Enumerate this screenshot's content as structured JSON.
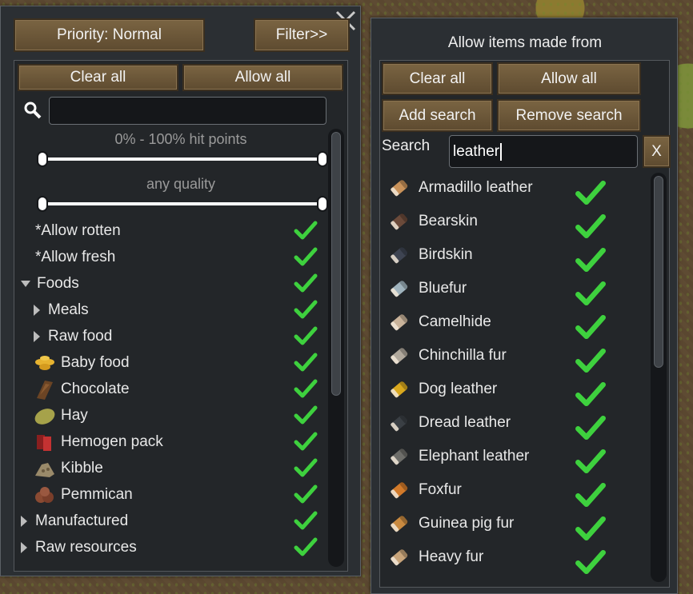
{
  "colors": {
    "check": "#3ed13e",
    "button": "#6f5a3a",
    "panel": "#2b2f33"
  },
  "left": {
    "priority_label": "Priority: Normal",
    "filter_label": "Filter>>",
    "clear_all": "Clear all",
    "allow_all": "Allow all",
    "search_value": "",
    "hitpoints_label": "0% - 100% hit points",
    "hitpoints_range": [
      0,
      100
    ],
    "quality_label": "any quality",
    "rows": [
      {
        "label": "*Allow rotten",
        "indent": 0,
        "icon": "none",
        "checked": true
      },
      {
        "label": "*Allow fresh",
        "indent": 0,
        "icon": "none",
        "checked": true
      },
      {
        "label": "Foods",
        "indent": 0,
        "icon": "expanded-triangle-icon",
        "checked": true
      },
      {
        "label": "Meals",
        "indent": 1,
        "icon": "collapsed-triangle-icon",
        "checked": true
      },
      {
        "label": "Raw food",
        "indent": 1,
        "icon": "collapsed-triangle-icon",
        "checked": true
      },
      {
        "label": "Baby food",
        "indent": 1,
        "icon": "baby-food-icon",
        "checked": true
      },
      {
        "label": "Chocolate",
        "indent": 1,
        "icon": "chocolate-icon",
        "checked": true
      },
      {
        "label": "Hay",
        "indent": 1,
        "icon": "hay-icon",
        "checked": true
      },
      {
        "label": "Hemogen pack",
        "indent": 1,
        "icon": "hemogen-pack-icon",
        "checked": true
      },
      {
        "label": "Kibble",
        "indent": 1,
        "icon": "kibble-icon",
        "checked": true
      },
      {
        "label": "Pemmican",
        "indent": 1,
        "icon": "pemmican-icon",
        "checked": true
      },
      {
        "label": "Manufactured",
        "indent": 0,
        "icon": "collapsed-triangle-icon",
        "checked": true
      },
      {
        "label": "Raw resources",
        "indent": 0,
        "icon": "collapsed-triangle-icon",
        "checked": true
      }
    ]
  },
  "right": {
    "title": "Allow items made from",
    "clear_all": "Clear all",
    "allow_all": "Allow all",
    "add_search": "Add search",
    "remove_search": "Remove search",
    "search_label": "Search",
    "search_value": "leather",
    "clear_x": "X",
    "items": [
      {
        "label": "Armadillo leather",
        "color": "#c9925a",
        "checked": true
      },
      {
        "label": "Bearskin",
        "color": "#6b4a3a",
        "checked": true
      },
      {
        "label": "Birdskin",
        "color": "#3e4452",
        "checked": true
      },
      {
        "label": "Bluefur",
        "color": "#9fb3bd",
        "checked": true
      },
      {
        "label": "Camelhide",
        "color": "#c9b39a",
        "checked": true
      },
      {
        "label": "Chinchilla fur",
        "color": "#b0a89c",
        "checked": true
      },
      {
        "label": "Dog leather",
        "color": "#d9a81e",
        "checked": true
      },
      {
        "label": "Dread leather",
        "color": "#3a3f44",
        "checked": true
      },
      {
        "label": "Elephant leather",
        "color": "#6e6e6a",
        "checked": true
      },
      {
        "label": "Foxfur",
        "color": "#d27a2a",
        "checked": true
      },
      {
        "label": "Guinea pig fur",
        "color": "#c98a40",
        "checked": true
      },
      {
        "label": "Heavy fur",
        "color": "#c8a47a",
        "checked": true
      }
    ]
  }
}
